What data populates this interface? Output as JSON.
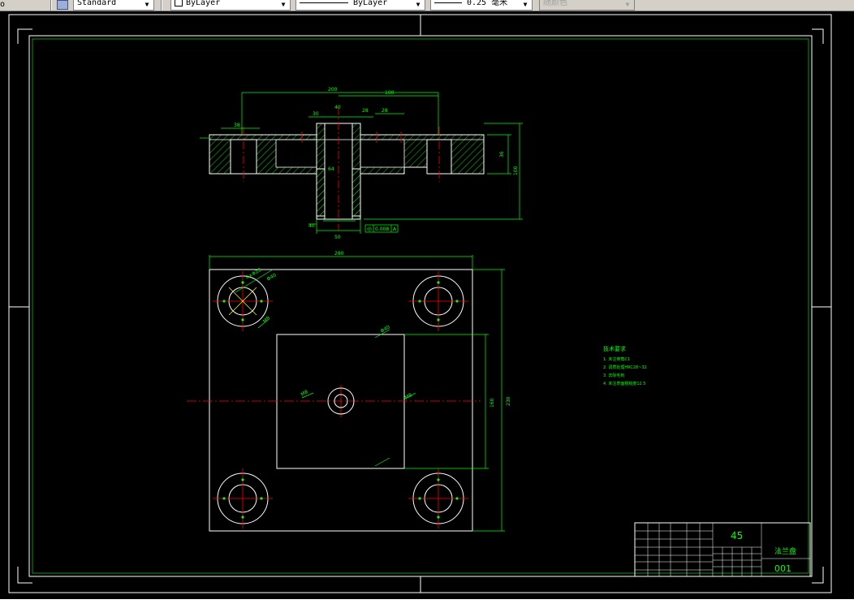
{
  "toolbar": {
    "partial_left": "o",
    "text_style": "Standard",
    "layer": "ByLayer",
    "linetype": "ByLayer",
    "lineweight": "0.25 毫米",
    "plot_style": "随颜色"
  },
  "drawing": {
    "section_dims": {
      "overall_width": "200",
      "half_width": "100",
      "left_bore": "38",
      "right_bore": "28",
      "thickness": "36",
      "height": "100",
      "bottom_width": "50",
      "mid_dim": "64",
      "small_dim": "40",
      "top_dims": [
        "30",
        "40",
        "28"
      ]
    },
    "tolerance_frame": {
      "symbol": "◎",
      "value": "0.008",
      "datum": "A"
    },
    "plan_dims": {
      "width": "280",
      "height": "230",
      "inner_height": "160",
      "hole_callout": "4×Φ28",
      "inner_callouts": [
        "Φ40",
        "M8",
        "Φ40",
        "M8",
        "M8"
      ]
    },
    "notes": {
      "title": "技术要求",
      "items": [
        "1. 未注倒角C1",
        "2. 调质处理HRC28~32",
        "3. 去除毛刺",
        "4. 未注表面粗糙度12.5"
      ]
    },
    "title_block": {
      "material": "45",
      "part_name": "法兰盘",
      "drawing_no": "001"
    }
  },
  "colors": {
    "background": "#000000",
    "white_lines": "#ffffff",
    "dimension": "#00ff00",
    "center_line": "#ff0000",
    "hidden": "#ffff00",
    "frame": "#00ff00"
  }
}
